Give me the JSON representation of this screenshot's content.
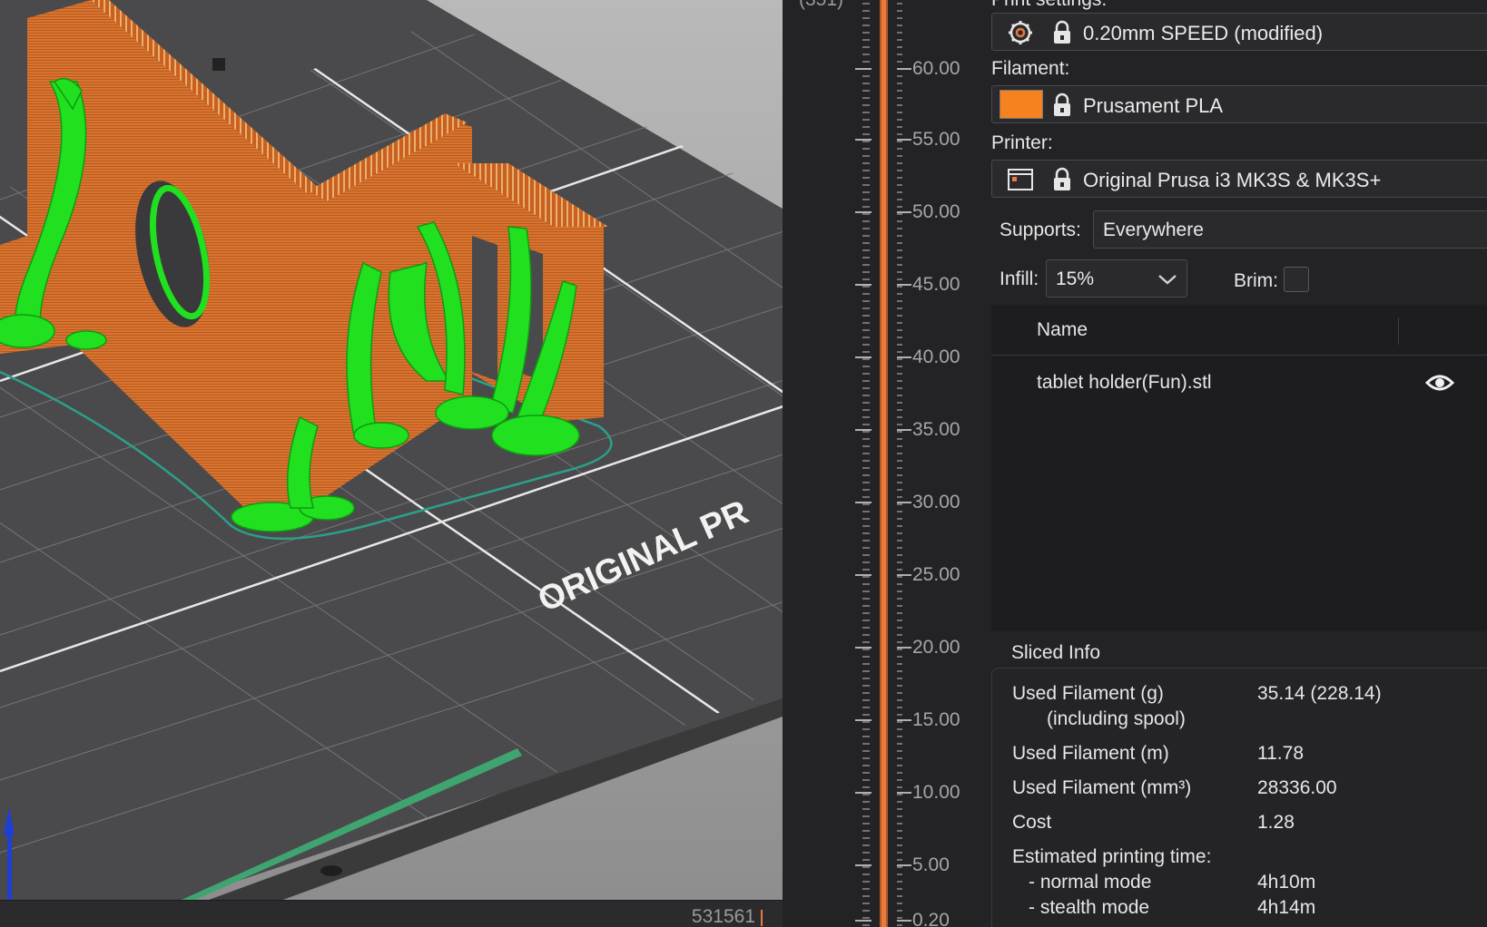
{
  "viewport": {
    "bed_label": "ORIGINAL PR",
    "layer_count": "531561"
  },
  "layer_slider": {
    "top_label": "(351)",
    "ticks": [
      "60.00",
      "55.00",
      "50.00",
      "45.00",
      "40.00",
      "35.00",
      "30.00",
      "25.00",
      "20.00",
      "15.00",
      "10.00",
      "5.00",
      "0.20"
    ]
  },
  "panel": {
    "print_settings_label": "Print settings:",
    "print_settings_value": "0.20mm SPEED (modified)",
    "filament_label": "Filament:",
    "filament_value": "Prusament PLA",
    "filament_color": "#f5821f",
    "printer_label": "Printer:",
    "printer_value": "Original Prusa i3 MK3S & MK3S+",
    "supports_label": "Supports:",
    "supports_value": "Everywhere",
    "infill_label": "Infill:",
    "infill_value": "15%",
    "brim_label": "Brim:",
    "list_header_name": "Name",
    "object_name": "tablet holder(Fun).stl"
  },
  "sliced_info": {
    "title": "Sliced Info",
    "rows": [
      {
        "label": "Used Filament (g)",
        "value": "35.14 (228.14)"
      },
      {
        "label": "(including spool)",
        "value": ""
      },
      {
        "label": "Used Filament (m)",
        "value": "11.78"
      },
      {
        "label": "Used Filament (mm³)",
        "value": "28336.00"
      },
      {
        "label": "Cost",
        "value": "1.28"
      },
      {
        "label": "Estimated printing time:",
        "value": ""
      },
      {
        "label": "- normal mode",
        "value": "4h10m"
      },
      {
        "label": "- stealth mode",
        "value": "4h14m"
      }
    ]
  },
  "colors": {
    "accent": "#ea7a3c",
    "model_orange": "#d9742f",
    "support_green": "#20e020"
  }
}
